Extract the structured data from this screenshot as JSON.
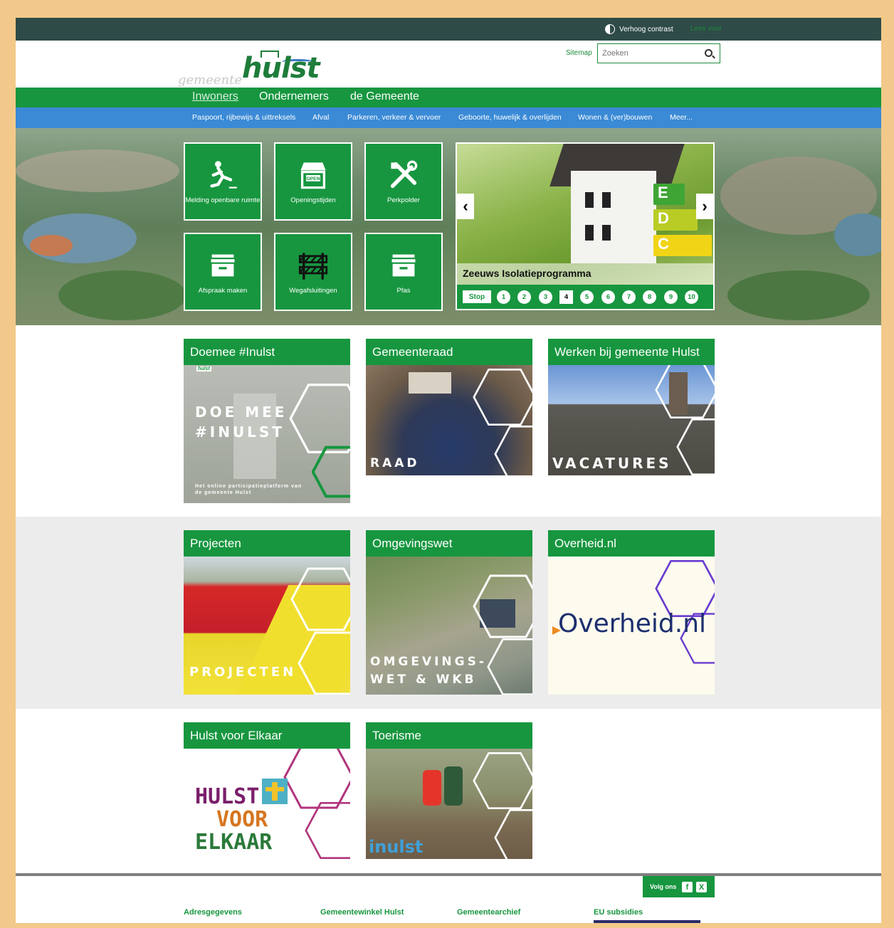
{
  "topbar": {
    "contrast_label": "Verhoog contrast",
    "read_aloud_label": "Lees voor"
  },
  "header": {
    "logo_prefix": "gemeente",
    "logo_name": "hulst",
    "sitemap_label": "Sitemap",
    "search_placeholder": "Zoeken"
  },
  "main_nav": [
    "Inwoners",
    "Ondernemers",
    "de Gemeente"
  ],
  "sub_nav": [
    "Paspoort, rijbewijs & uittreksels",
    "Afval",
    "Parkeren, verkeer & vervoer",
    "Geboorte, huwelijk & overlijden",
    "Wonen & (ver)bouwen",
    "Meer..."
  ],
  "tiles": [
    {
      "label": "Melding openbare ruimte",
      "icon": "slip-icon"
    },
    {
      "label": "Openingstijden",
      "icon": "shop-open-icon"
    },
    {
      "label": "Perkpolder",
      "icon": "tools-icon"
    },
    {
      "label": "Afspraak maken",
      "icon": "archive-box-icon"
    },
    {
      "label": "Wegafsluitingen",
      "icon": "road-barrier-icon"
    },
    {
      "label": "Pfas",
      "icon": "archive-box-icon"
    }
  ],
  "slider": {
    "caption": "Zeeuws Isolatieprogramma",
    "stop_label": "Stop",
    "energy_labels": [
      "E",
      "D",
      "C"
    ],
    "pages": [
      "1",
      "2",
      "3",
      "4",
      "5",
      "6",
      "7",
      "8",
      "9",
      "10"
    ],
    "active_page": "4",
    "prev_icon": "chevron-left-icon",
    "next_icon": "chevron-right-icon"
  },
  "cards": [
    {
      "title": "Doemee #Inulst",
      "overlay": "DOE MEE #INULST",
      "subtext": "Het online participatieplatform van de gemeente Hulst",
      "badge": "hulst"
    },
    {
      "title": "Gemeenteraad",
      "overlay": "RAAD"
    },
    {
      "title": "Werken bij gemeente Hulst",
      "overlay": "VACATURES"
    },
    {
      "title": "Projecten",
      "overlay": "PROJECTEN"
    },
    {
      "title": "Omgevingswet",
      "overlay": "OMGEVINGS-WET & WKB"
    },
    {
      "title": "Overheid.nl",
      "overlay": "Overheid.nl"
    },
    {
      "title": "Hulst voor Elkaar",
      "overlay_lines": [
        "HULST",
        "VOOR",
        "ELKAAR"
      ]
    },
    {
      "title": "Toerisme",
      "overlay": "inulst"
    }
  ],
  "footer": {
    "follow_label": "Volg ons",
    "social": [
      "f",
      "X"
    ],
    "columns": [
      "Adresgegevens",
      "Gemeentewinkel Hulst",
      "Gemeentearchief",
      "EU subsidies"
    ]
  },
  "colors": {
    "green": "#17963f",
    "blue": "#3a8ad6",
    "topbar": "#2e4b48",
    "frame": "#f2c98a"
  }
}
